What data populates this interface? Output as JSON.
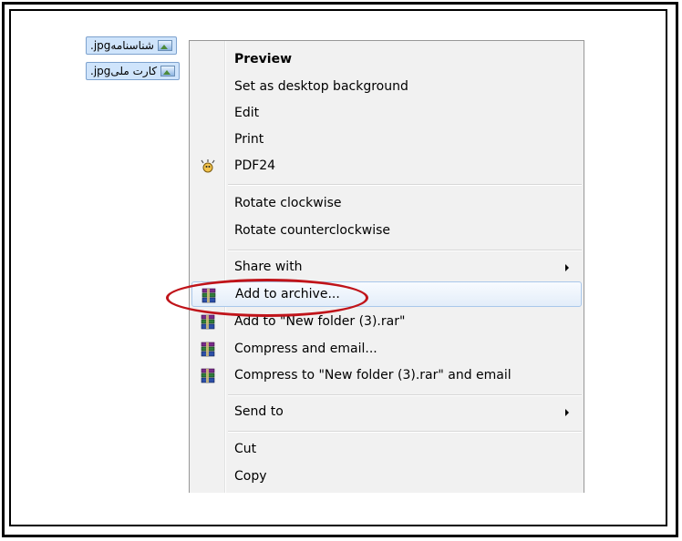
{
  "files": [
    {
      "name": ".jpgشناسنامه"
    },
    {
      "name": ".jpgکارت ملی"
    }
  ],
  "menu": {
    "items": [
      {
        "label": "Preview",
        "bold": true
      },
      {
        "label": "Set as desktop background"
      },
      {
        "label": "Edit"
      },
      {
        "label": "Print"
      },
      {
        "label": "PDF24",
        "icon": "pdf24-icon"
      },
      {
        "label": "Rotate clockwise"
      },
      {
        "label": "Rotate counterclockwise"
      },
      {
        "label": "Share with",
        "submenu": true
      },
      {
        "label": "Add to archive...",
        "icon": "winrar-icon",
        "highlighted": true
      },
      {
        "label": "Add to \"New folder (3).rar\"",
        "icon": "winrar-icon"
      },
      {
        "label": "Compress and email...",
        "icon": "winrar-icon"
      },
      {
        "label": "Compress to \"New folder (3).rar\" and email",
        "icon": "winrar-icon"
      },
      {
        "label": "Send to",
        "submenu": true
      },
      {
        "label": "Cut"
      },
      {
        "label": "Copy"
      }
    ]
  },
  "colors": {
    "annotation": "#c0141a",
    "highlight_border": "#a9c7ea",
    "selection_bg": "#cfe4fb"
  }
}
